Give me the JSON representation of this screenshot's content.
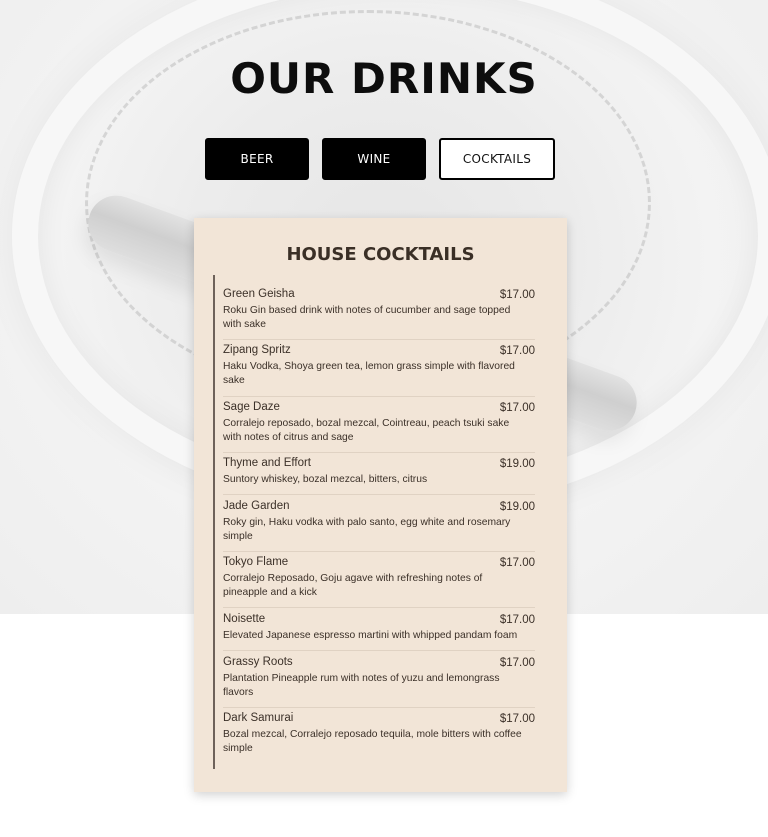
{
  "page": {
    "title": "OUR DRINKS"
  },
  "tabs": [
    {
      "label": "BEER",
      "active": false
    },
    {
      "label": "WINE",
      "active": false
    },
    {
      "label": "COCKTAILS",
      "active": true
    }
  ],
  "menu": {
    "section_title": "HOUSE COCKTAILS",
    "items": [
      {
        "name": "Green Geisha",
        "price": "$17.00",
        "description": "Roku Gin based drink with notes of cucumber and sage topped with sake"
      },
      {
        "name": "Zipang Spritz",
        "price": "$17.00",
        "description": "Haku Vodka, Shoya green tea, lemon grass simple with flavored sake"
      },
      {
        "name": "Sage Daze",
        "price": "$17.00",
        "description": "Corralejo reposado, bozal mezcal, Cointreau, peach tsuki sake with notes of citrus and sage"
      },
      {
        "name": "Thyme and Effort",
        "price": "$19.00",
        "description": "Suntory whiskey, bozal mezcal, bitters, citrus"
      },
      {
        "name": "Jade Garden",
        "price": "$19.00",
        "description": "Roky gin, Haku vodka with palo santo, egg white and rosemary simple"
      },
      {
        "name": "Tokyo Flame",
        "price": "$17.00",
        "description": "Corralejo Reposado, Goju agave with refreshing notes of pineapple and a kick"
      },
      {
        "name": "Noisette",
        "price": "$17.00",
        "description": "Elevated Japanese espresso martini with whipped pandam foam"
      },
      {
        "name": "Grassy Roots",
        "price": "$17.00",
        "description": "Plantation Pineapple rum with notes of yuzu and lemongrass flavors"
      },
      {
        "name": "Dark Samurai",
        "price": "$17.00",
        "description": "Bozal mezcal, Corralejo reposado tequila, mole bitters with coffee simple"
      }
    ]
  },
  "colors": {
    "card_background": "#f2e5d7",
    "tab_dark": "#000000",
    "tab_light": "#ffffff",
    "text_dark": "#3b3028"
  }
}
